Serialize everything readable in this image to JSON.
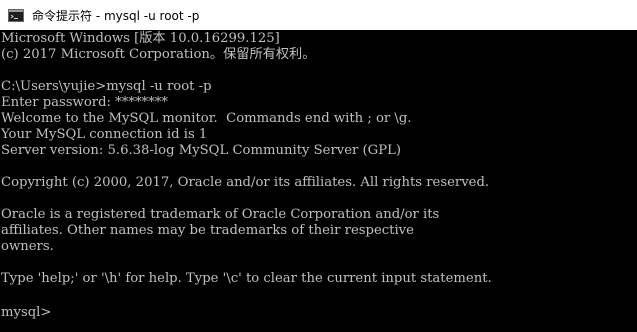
{
  "window": {
    "title": "命令提示符 - mysql  -u root -p",
    "icon": "cmd-icon"
  },
  "console": {
    "lines": [
      "Microsoft Windows [版本 10.0.16299.125]",
      "(c) 2017 Microsoft Corporation。保留所有权利。",
      "",
      "C:\\Users\\yujie>mysql -u root -p",
      "Enter password: ********",
      "Welcome to the MySQL monitor.  Commands end with ; or \\g.",
      "Your MySQL connection id is 1",
      "Server version: 5.6.38-log MySQL Community Server (GPL)",
      "",
      "Copyright (c) 2000, 2017, Oracle and/or its affiliates. All rights reserved.",
      "",
      "Oracle is a registered trademark of Oracle Corporation and/or its",
      "affiliates. Other names may be trademarks of their respective",
      "owners.",
      "",
      "Type 'help;' or '\\h' for help. Type '\\c' to clear the current input statement.",
      ""
    ],
    "prompt": "mysql>"
  },
  "colors": {
    "background": "#000000",
    "text": "#c0c0c0",
    "titlebar": "#ffffff"
  }
}
